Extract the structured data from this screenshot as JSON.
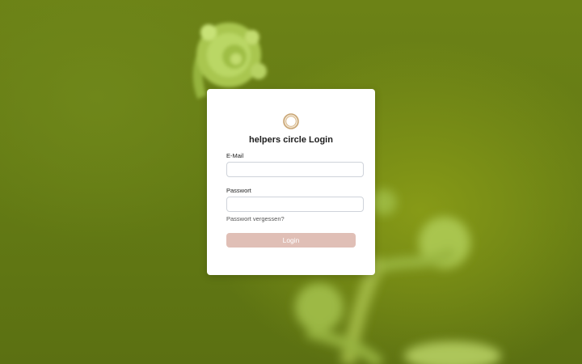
{
  "page": {
    "title": "helpers circle Login"
  },
  "form": {
    "email_label": "E-Mail",
    "email_value": "",
    "password_label": "Passwort",
    "password_value": "",
    "forgot_link": "Passwort vergessen?",
    "login_button": "Login"
  },
  "icons": {
    "logo": "helpers-circle-logo",
    "background": "fern-fiddlehead-photo"
  },
  "colors": {
    "button_disabled": "#e0bfb6",
    "logo_ring": "#c9a574",
    "background_green": "#6c8216"
  }
}
